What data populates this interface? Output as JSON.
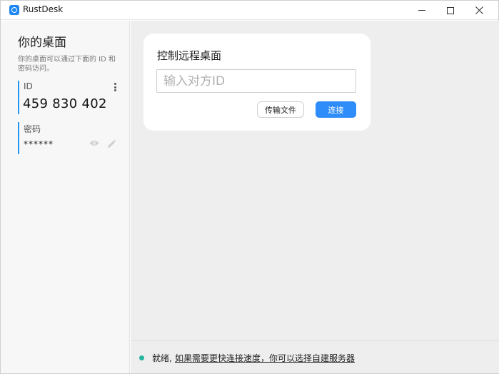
{
  "window": {
    "title": "RustDesk",
    "icon": "rustdesk-logo-icon",
    "controls": [
      "minimize-icon",
      "maximize-icon",
      "close-icon"
    ]
  },
  "sidebar": {
    "title": "你的桌面",
    "description": "你的桌面可以通过下面的 ID 和密码访问。",
    "id_label": "ID",
    "id_value": "459 830 402",
    "password_label": "密码",
    "password_value": "******",
    "id_menu_icon": "more-vertical-icon",
    "show_password_icon": "eye-icon",
    "edit_password_icon": "pencil-icon"
  },
  "connect_card": {
    "title": "控制远程桌面",
    "input_placeholder": "输入对方ID",
    "input_value": "",
    "transfer_button": "传输文件",
    "connect_button": "连接"
  },
  "status": {
    "ready_text": "就绪,",
    "link_text": "如果需要更快连接速度，你可以选择自建服务器",
    "indicator_color": "#26b3a0"
  },
  "colors": {
    "accent": "#2f8dfa",
    "field_bar": "#2196f3"
  }
}
